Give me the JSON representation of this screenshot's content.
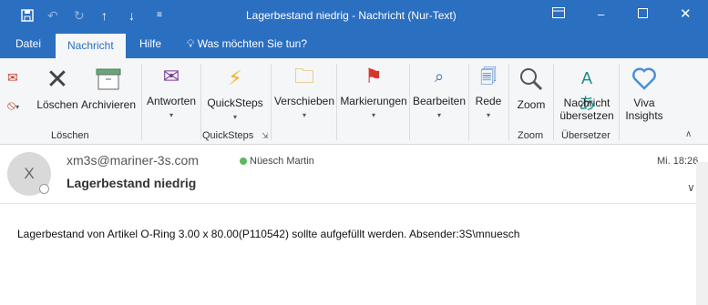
{
  "window": {
    "title": "Lagerbestand niedrig  -  Nachricht (Nur-Text)",
    "icons": [
      "save-icon",
      "undo-icon",
      "redo-icon",
      "up-arrow-icon",
      "down-arrow-icon",
      "more-icon"
    ]
  },
  "tabs": [
    {
      "label": "Datei"
    },
    {
      "label": "Nachricht",
      "active": true
    },
    {
      "label": "Hilfe"
    },
    {
      "label": "Was möchten Sie tun?"
    }
  ],
  "ribbon": {
    "delete_label": "Löschen",
    "archive_label": "Archivieren",
    "group_delete": "Löschen",
    "respond_label": "Antworten",
    "quicksteps_label": "QuickSteps",
    "group_quicksteps": "QuickSteps",
    "move_label": "Verschieben",
    "tags_label": "Markierungen",
    "edit_label": "Bearbeiten",
    "speech_label": "Rede",
    "zoom_label": "Zoom",
    "group_zoom": "Zoom",
    "translate_label_1": "Nachricht",
    "translate_label_2": "übersetzen",
    "group_translate": "Übersetzer",
    "viva_label_1": "Viva",
    "viva_label_2": "Insights"
  },
  "message": {
    "avatar": "X",
    "from": "xm3s@mariner-3s.com",
    "recipient": "Nüesch Martin",
    "subject": "Lagerbestand niedrig",
    "time": "Mi. 18:26",
    "body": "Lagerbestand von Artikel O-Ring 3.00 x 80.00(P110542) sollte aufgefüllt werden. Absender:3S\\mnuesch"
  },
  "colors": {
    "accent": "#2b6fc1"
  }
}
